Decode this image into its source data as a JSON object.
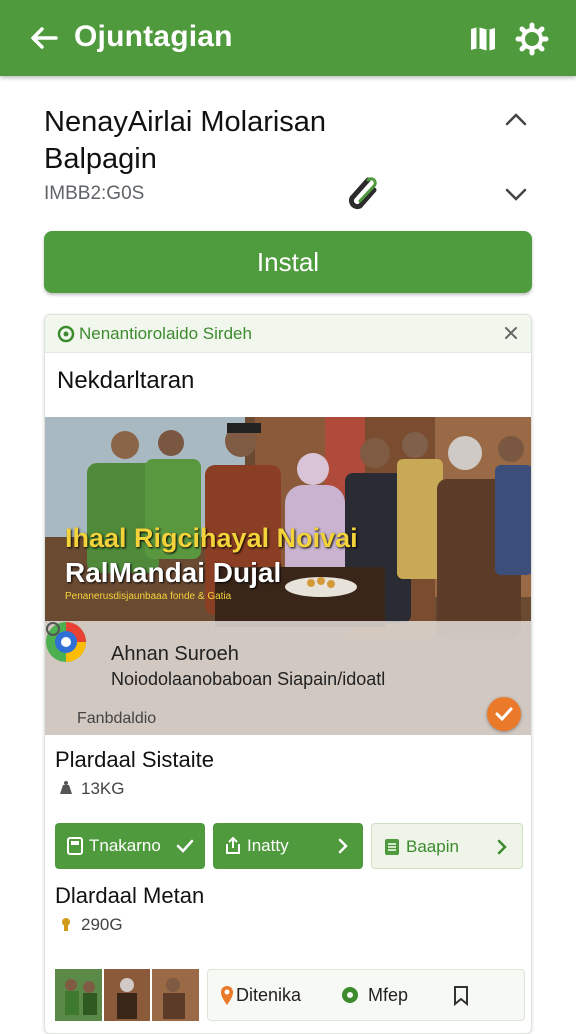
{
  "appbar": {
    "title": "Ojuntagian",
    "bg": "#4e9a3d"
  },
  "header": {
    "title": "NenayAirlai Molarisan Balpagin",
    "meta": "IMBB2:G0S"
  },
  "install": {
    "label": "Instal",
    "color": "#4f9c3f"
  },
  "card": {
    "header_label": "Nenantiorolaido Sirdeh",
    "subtitle": "Nekdarltaran",
    "photo": {
      "caption_line1": "Ihaal Rigcihayal Noivai",
      "caption_line2": "RalMandai Dujal",
      "caption_small": "Penanerusdisjaunbaaa fonde & Gatia",
      "overlay_title": "Ahnan Suroeh",
      "overlay_desc": "Noiodolaanobaboan Siapain/idoatl",
      "source": "Fanbdaldio"
    },
    "item1": {
      "title": "Plardaal Sistaite",
      "meta": "13KG"
    },
    "chips": [
      {
        "label": "Tnakarno"
      },
      {
        "label": "Inatty"
      },
      {
        "label": "Baapin"
      }
    ],
    "item2": {
      "title": "Dlardaal Metan",
      "meta": "290G"
    },
    "bottom": {
      "label1": "Ditenika",
      "label2": "Mfep"
    }
  },
  "icons": [
    "arrow-back-icon",
    "map-icon",
    "settings-icon",
    "chevron-up-icon",
    "chevron-down-icon",
    "paperclip-icon",
    "close-icon",
    "check-icon",
    "chevron-right-icon",
    "pin-icon",
    "bookmark-icon",
    "location-icon",
    "weight-icon"
  ],
  "colors": {
    "accent": "#4e9a3d",
    "accent_light": "#eef5e8",
    "orange": "#ea7a2a",
    "caption_yellow": "#f3d23a"
  }
}
